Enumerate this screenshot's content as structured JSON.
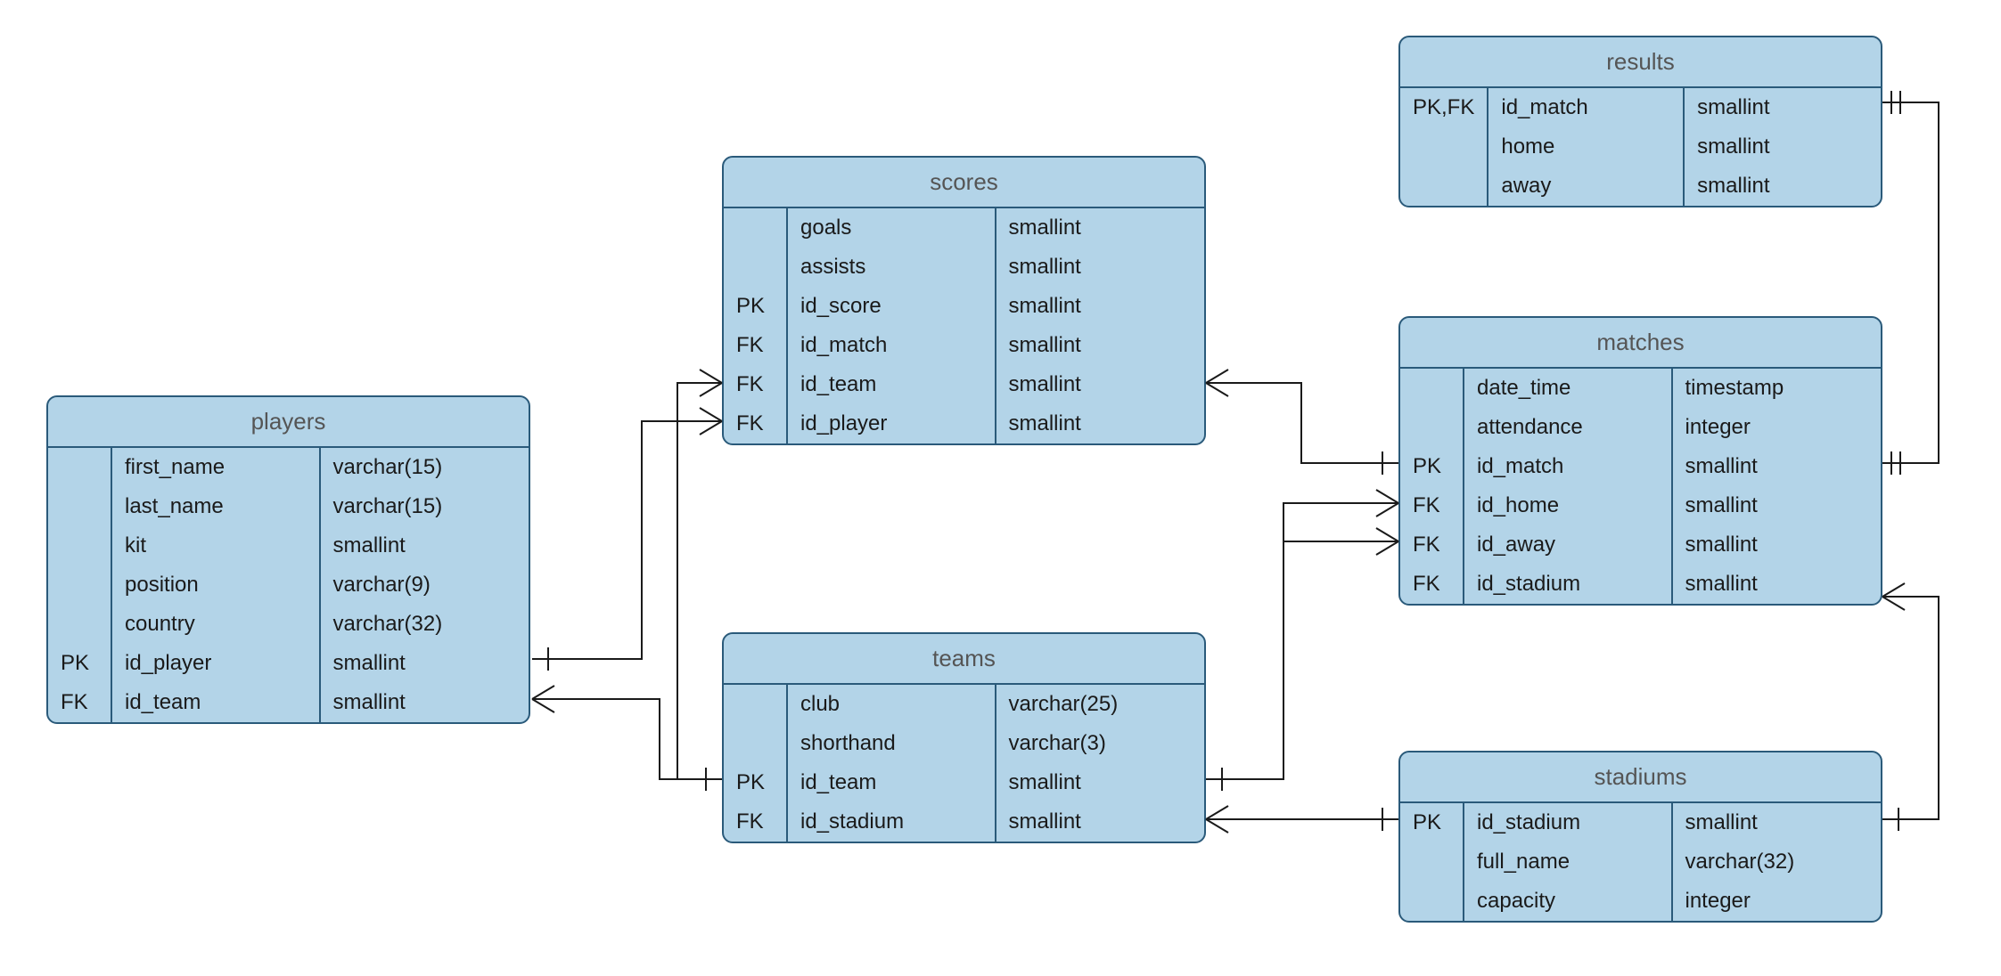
{
  "entities": {
    "players": {
      "title": "players",
      "rows": [
        {
          "key": "",
          "name": "first_name",
          "type": "varchar(15)"
        },
        {
          "key": "",
          "name": "last_name",
          "type": "varchar(15)"
        },
        {
          "key": "",
          "name": "kit",
          "type": "smallint"
        },
        {
          "key": "",
          "name": "position",
          "type": "varchar(9)"
        },
        {
          "key": "",
          "name": "country",
          "type": "varchar(32)"
        },
        {
          "key": "PK",
          "name": "id_player",
          "type": "smallint"
        },
        {
          "key": "FK",
          "name": "id_team",
          "type": "smallint"
        }
      ]
    },
    "scores": {
      "title": "scores",
      "rows": [
        {
          "key": "",
          "name": "goals",
          "type": "smallint"
        },
        {
          "key": "",
          "name": "assists",
          "type": "smallint"
        },
        {
          "key": "PK",
          "name": "id_score",
          "type": "smallint"
        },
        {
          "key": "FK",
          "name": "id_match",
          "type": "smallint"
        },
        {
          "key": "FK",
          "name": "id_team",
          "type": "smallint"
        },
        {
          "key": "FK",
          "name": "id_player",
          "type": "smallint"
        }
      ]
    },
    "teams": {
      "title": "teams",
      "rows": [
        {
          "key": "",
          "name": "club",
          "type": "varchar(25)"
        },
        {
          "key": "",
          "name": "shorthand",
          "type": "varchar(3)"
        },
        {
          "key": "PK",
          "name": "id_team",
          "type": "smallint"
        },
        {
          "key": "FK",
          "name": "id_stadium",
          "type": "smallint"
        }
      ]
    },
    "results": {
      "title": "results",
      "rows": [
        {
          "key": "PK,FK",
          "name": "id_match",
          "type": "smallint"
        },
        {
          "key": "",
          "name": "home",
          "type": "smallint"
        },
        {
          "key": "",
          "name": "away",
          "type": "smallint"
        }
      ]
    },
    "matches": {
      "title": "matches",
      "rows": [
        {
          "key": "",
          "name": "date_time",
          "type": "timestamp"
        },
        {
          "key": "",
          "name": "attendance",
          "type": "integer"
        },
        {
          "key": "PK",
          "name": "id_match",
          "type": "smallint"
        },
        {
          "key": "FK",
          "name": "id_home",
          "type": "smallint"
        },
        {
          "key": "FK",
          "name": "id_away",
          "type": "smallint"
        },
        {
          "key": "FK",
          "name": "id_stadium",
          "type": "smallint"
        }
      ]
    },
    "stadiums": {
      "title": "stadiums",
      "rows": [
        {
          "key": "PK",
          "name": "id_stadium",
          "type": "smallint"
        },
        {
          "key": "",
          "name": "full_name",
          "type": "varchar(32)"
        },
        {
          "key": "",
          "name": "capacity",
          "type": "integer"
        }
      ]
    }
  },
  "colors": {
    "entity_bg": "#b3d4e8",
    "entity_border": "#2a5a7a"
  }
}
